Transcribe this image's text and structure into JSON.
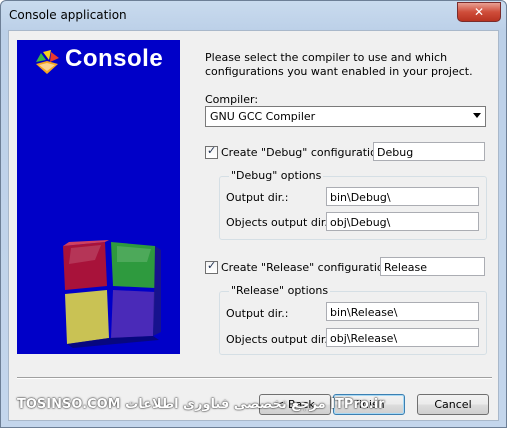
{
  "window": {
    "title": "Console application",
    "close_glyph": "✕"
  },
  "banner": {
    "title": "Console",
    "logo_icon": "codeblocks-logo-icon",
    "image": "colored-cube-image"
  },
  "intro": "Please select the compiler to use and which configurations you want enabled in your project.",
  "compiler": {
    "label": "Compiler:",
    "selected": "GNU GCC Compiler"
  },
  "debug": {
    "checkbox_label": "Create \"Debug\" configuration:",
    "checked": true,
    "name": "Debug",
    "group_title": "\"Debug\" options",
    "output_dir_label": "Output dir.:",
    "output_dir": "bin\\Debug\\",
    "objects_dir_label": "Objects output dir.:",
    "objects_dir": "obj\\Debug\\"
  },
  "release": {
    "checkbox_label": "Create \"Release\" configuration:",
    "checked": true,
    "name": "Release",
    "group_title": "\"Release\" options",
    "output_dir_label": "Output dir.:",
    "output_dir": "bin\\Release\\",
    "objects_dir_label": "Objects output dir.:",
    "objects_dir": "obj\\Release\\"
  },
  "buttons": {
    "back": "< Back",
    "finish": "Finish",
    "cancel": "Cancel"
  },
  "watermark": "TOSINSO.COM مرجع تخصصی فناوری اطلاعات ITPro.ir"
}
